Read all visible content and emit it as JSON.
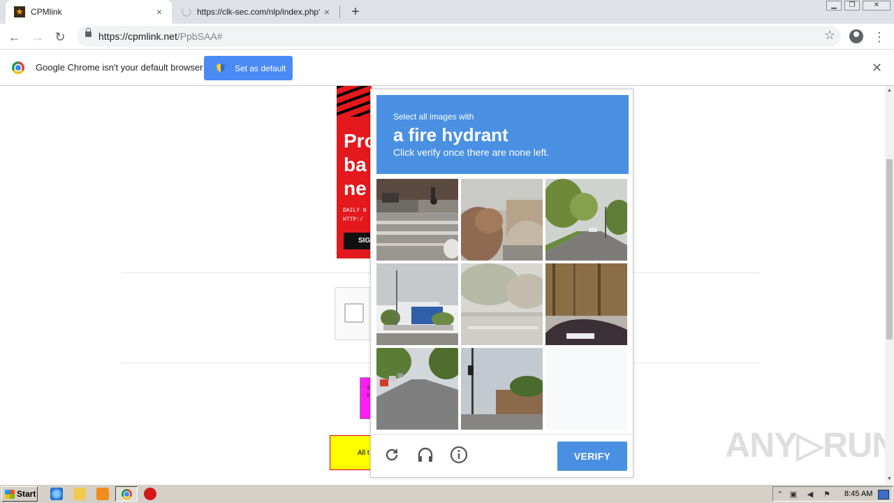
{
  "browser": {
    "tabs": [
      {
        "title": "CPMlink",
        "active": true,
        "close": "×"
      },
      {
        "title": "https://clk-sec.com/nlp/index.php?a",
        "active": false,
        "loading": true,
        "close": "×"
      }
    ],
    "new_tab": "+",
    "address": {
      "domain": "https://cpmlink.net",
      "path": "/PpbSAA#"
    },
    "icons": {
      "back": "←",
      "forward": "→",
      "reload": "↻",
      "bookmark": "☆",
      "menu": "⋮"
    }
  },
  "infobar": {
    "message": "Google Chrome isn't your default browser",
    "button": "Set as default",
    "close": "✕"
  },
  "page": {
    "ad": {
      "lines": [
        "Pro",
        "ba",
        "ne"
      ],
      "small_lines": [
        "DAILY N",
        "HTTP:/"
      ],
      "button": "SIG"
    },
    "magenta_text": [
      "S",
      "to"
    ],
    "yellow_text": "All t",
    "watermark": "ANY▷RUN"
  },
  "captcha": {
    "instruction_small": "Select all images with",
    "target": "a fire hydrant",
    "instruction_sub": "Click verify once there are none left.",
    "verify_label": "VERIFY",
    "header_color": "#4a90e2",
    "tiles": [
      {
        "name": "street-cyclist"
      },
      {
        "name": "trees-building"
      },
      {
        "name": "road-trees"
      },
      {
        "name": "parking-building"
      },
      {
        "name": "faded-street"
      },
      {
        "name": "woods-car"
      },
      {
        "name": "residential-street"
      },
      {
        "name": "intersection-shop"
      },
      {
        "name": "empty"
      }
    ]
  },
  "taskbar": {
    "start": "Start",
    "time": "8:45 AM"
  }
}
